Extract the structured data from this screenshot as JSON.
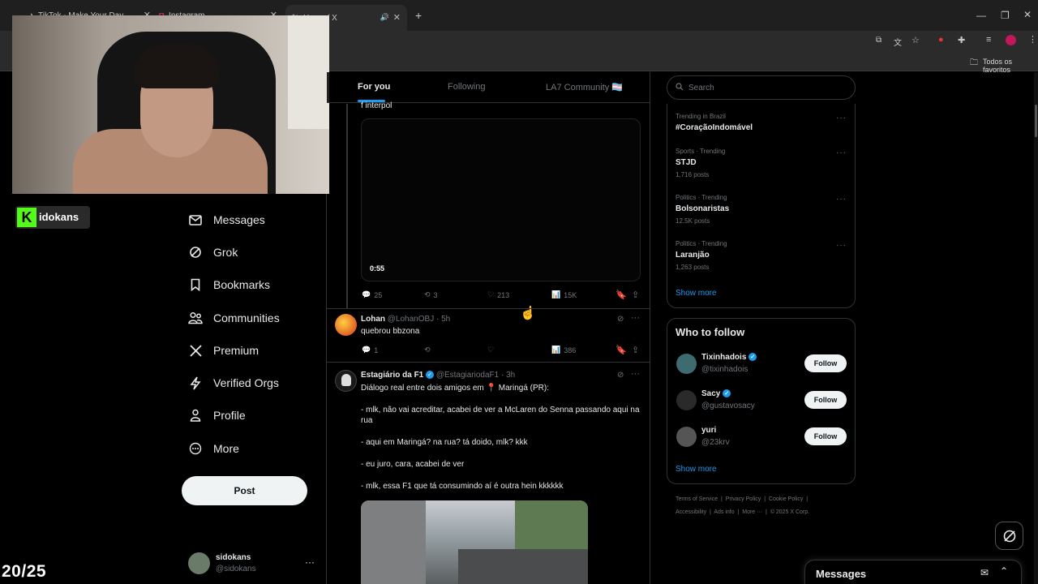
{
  "browser": {
    "tabs": [
      {
        "label": "TikTok - Make Your Day"
      },
      {
        "label": "Instagram"
      },
      {
        "label": "Home / X"
      }
    ],
    "bookmarks_label": "Todos os favoritos"
  },
  "stream": {
    "channel_name": "idokans",
    "counter": "20/25"
  },
  "sidebar": {
    "items": [
      {
        "label": "Messages",
        "icon": "envelope-icon"
      },
      {
        "label": "Grok",
        "icon": "grok-icon"
      },
      {
        "label": "Bookmarks",
        "icon": "bookmark-icon"
      },
      {
        "label": "Communities",
        "icon": "communities-icon"
      },
      {
        "label": "Premium",
        "icon": "x-logo-icon"
      },
      {
        "label": "Verified Orgs",
        "icon": "lightning-icon"
      },
      {
        "label": "Profile",
        "icon": "person-icon"
      },
      {
        "label": "More",
        "icon": "more-circle-icon"
      }
    ],
    "post_label": "Post",
    "account": {
      "name": "sidokans",
      "handle": "@sidokans"
    }
  },
  "feed": {
    "tabs": [
      {
        "label": "For you",
        "active": true
      },
      {
        "label": "Following"
      },
      {
        "label": "LA7 Community 🏳️‍⚧️"
      }
    ],
    "post1": {
      "text": "f interpol",
      "video_duration": "0:55",
      "replies": "25",
      "reposts": "3",
      "likes": "213",
      "views": "15K"
    },
    "post2": {
      "name": "Lohan",
      "handle": "@LohanOBJ · 5h",
      "text": "quebrou bbzona",
      "replies": "1",
      "views": "386"
    },
    "post3": {
      "name": "Estagiário da F1",
      "handle": "@EstagiariodaF1 · 3h",
      "line1": "Diálogo real entre dois amigos em 📍 Maringá (PR):",
      "line2": "- mlk, não vai acreditar, acabei de ver a McLaren do Senna passando aqui na rua",
      "line3": "- aqui em Maringá? na rua? tá doido, mlk? kkk",
      "line4": "- eu juro, cara, acabei de ver",
      "line5": "- mlk, essa F1 que tá consumindo aí é outra hein kkkkkk"
    }
  },
  "right": {
    "search_placeholder": "Search",
    "trends": [
      {
        "meta": "Trending in Brazil",
        "title": "#CoraçãoIndomável",
        "count": ""
      },
      {
        "meta": "Sports · Trending",
        "title": "STJD",
        "count": "1,716 posts"
      },
      {
        "meta": "Politics · Trending",
        "title": "Bolsonaristas",
        "count": "12.5K posts"
      },
      {
        "meta": "Politics · Trending",
        "title": "Laranjão",
        "count": "1,263 posts"
      }
    ],
    "show_more": "Show more",
    "who_to_follow_title": "Who to follow",
    "follow_label": "Follow",
    "suggestions": [
      {
        "name": "Tixinhadois",
        "handle": "@tixinhadois",
        "verified": true
      },
      {
        "name": "Sacy",
        "handle": "@gustavosacy",
        "verified": true
      },
      {
        "name": "yuri",
        "handle": "@23krv",
        "verified": false
      }
    ],
    "footer": {
      "line1": [
        "Terms of Service",
        "Privacy Policy",
        "Cookie Policy"
      ],
      "line2": [
        "Accessibility",
        "Ads info",
        "More ···",
        "© 2025 X Corp."
      ]
    },
    "messages_title": "Messages"
  },
  "colors": {
    "accent": "#1d9bf0",
    "bg": "#000000",
    "border": "#2f3336"
  }
}
